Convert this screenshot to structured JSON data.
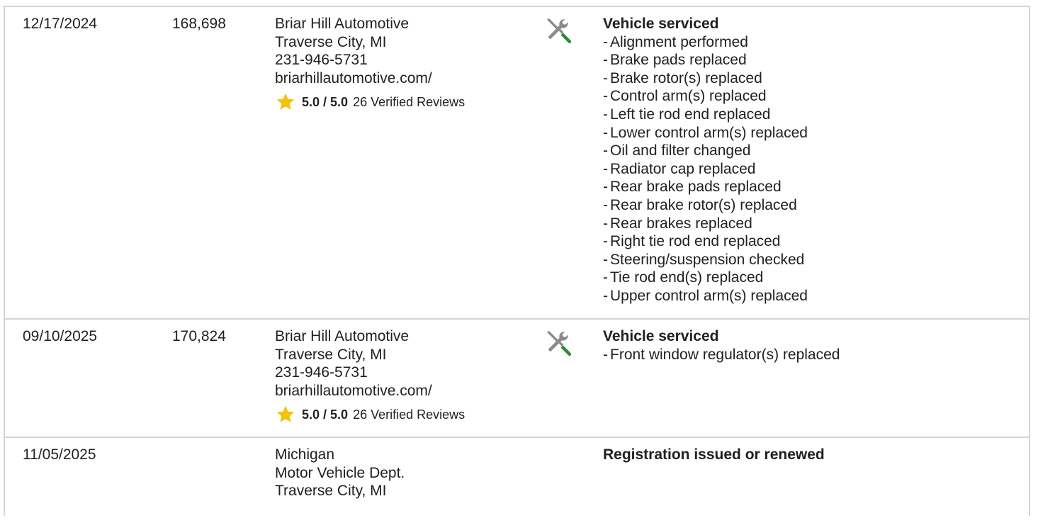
{
  "records": [
    {
      "date": "12/17/2024",
      "odometer": "168,698",
      "source": {
        "lines": [
          "Briar Hill Automotive",
          "Traverse City, MI",
          "231-946-5731",
          "briarhillautomotive.com/"
        ],
        "rating_score": "5.0 / 5.0",
        "rating_reviews": "26 Verified Reviews",
        "star_color": "#f4c20d"
      },
      "icon": "service-wrench-screwdriver-icon",
      "title": "Vehicle serviced",
      "items": [
        "Alignment performed",
        "Brake pads replaced",
        "Brake rotor(s) replaced",
        "Control arm(s) replaced",
        "Left tie rod end replaced",
        "Lower control arm(s) replaced",
        "Oil and filter changed",
        "Radiator cap replaced",
        "Rear brake pads replaced",
        "Rear brake rotor(s) replaced",
        "Rear brakes replaced",
        "Right tie rod end replaced",
        "Steering/suspension checked",
        "Tie rod end(s) replaced",
        "Upper control arm(s) replaced"
      ]
    },
    {
      "date": "09/10/2025",
      "odometer": "170,824",
      "source": {
        "lines": [
          "Briar Hill Automotive",
          "Traverse City, MI",
          "231-946-5731",
          "briarhillautomotive.com/"
        ],
        "rating_score": "5.0 / 5.0",
        "rating_reviews": "26 Verified Reviews",
        "star_color": "#f4c20d"
      },
      "icon": "service-wrench-screwdriver-icon",
      "title": "Vehicle serviced",
      "items": [
        "Front window regulator(s) replaced"
      ]
    },
    {
      "date": "11/05/2025",
      "odometer": "",
      "source": {
        "lines": [
          "Michigan",
          "Motor Vehicle Dept.",
          "Traverse City, MI"
        ]
      },
      "title": "Registration issued or renewed",
      "items": []
    }
  ],
  "colors": {
    "border": "#d4d4d4",
    "text": "#212121",
    "icon_gray": "#8a8a8a",
    "icon_green": "#2e8b3a",
    "star": "#f4c20d"
  }
}
